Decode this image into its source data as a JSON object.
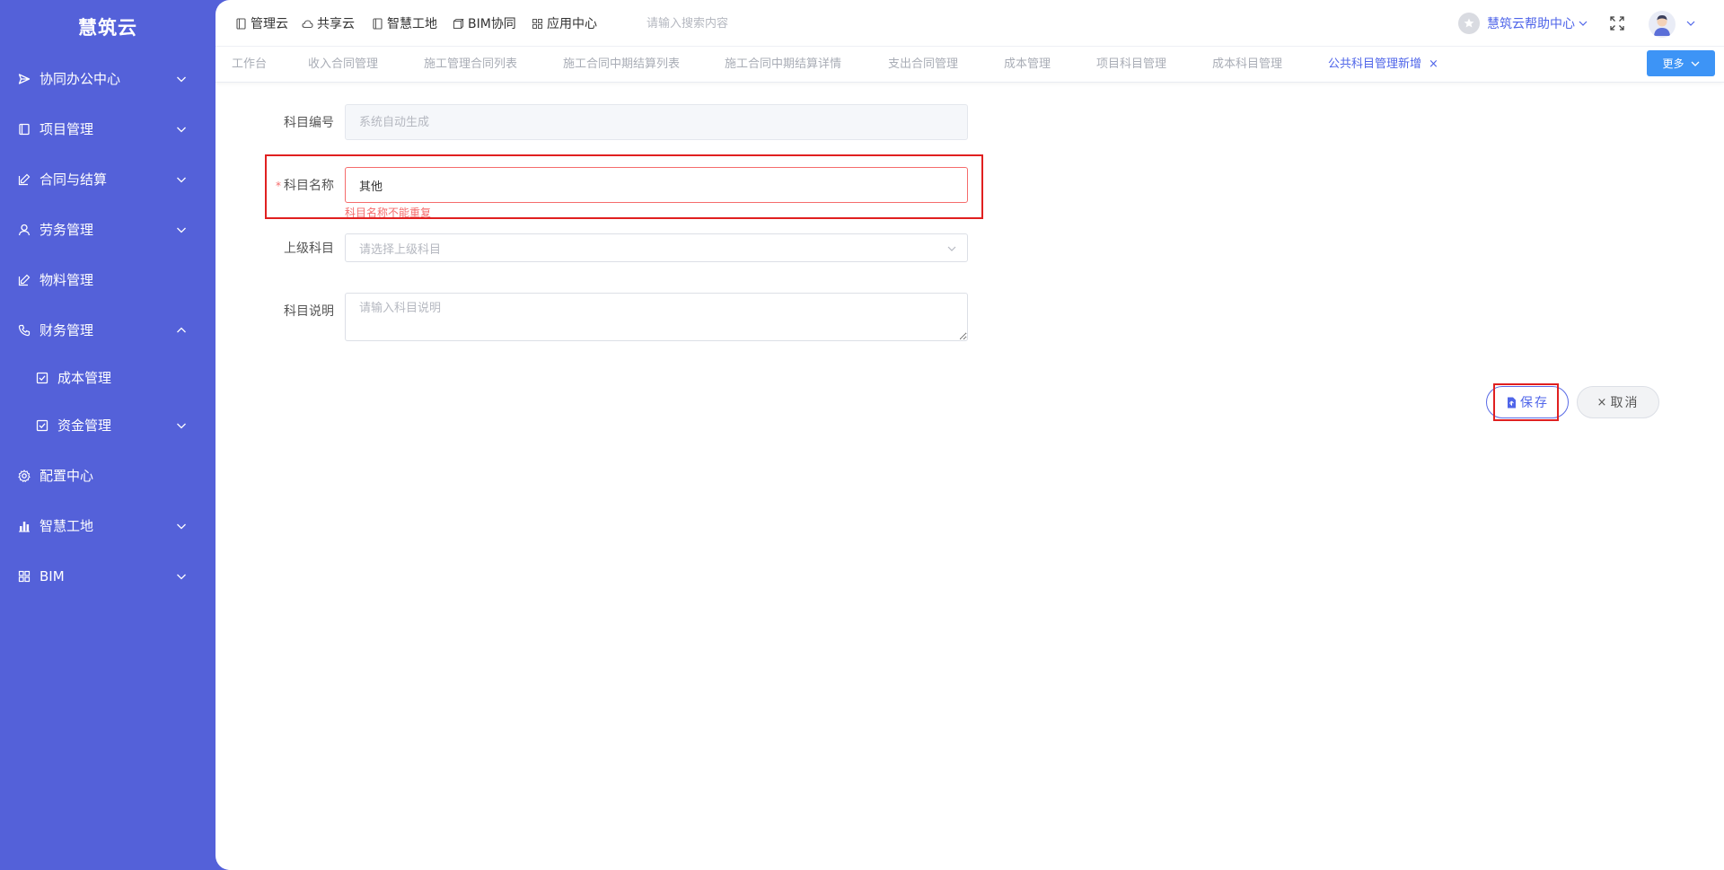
{
  "sidebar": {
    "brand": "慧筑云",
    "items": [
      {
        "label": "协同办公中心",
        "icon": "send-icon"
      },
      {
        "label": "项目管理",
        "icon": "book-icon"
      },
      {
        "label": "合同与结算",
        "icon": "edit-icon"
      },
      {
        "label": "劳务管理",
        "icon": "worker-icon"
      },
      {
        "label": "物料管理",
        "icon": "edit-icon"
      },
      {
        "label": "财务管理",
        "icon": "phone-icon",
        "expanded": true
      },
      {
        "label": "成本管理",
        "icon": "checkbox-icon",
        "sub": true
      },
      {
        "label": "资金管理",
        "icon": "checkbox-icon",
        "sub": true
      },
      {
        "label": "配置中心",
        "icon": "gear-icon"
      },
      {
        "label": "智慧工地",
        "icon": "bar-chart-icon"
      },
      {
        "label": "BIM",
        "icon": "grid-icon"
      }
    ]
  },
  "header": {
    "menus": [
      {
        "label": "管理云",
        "icon": "doc-icon"
      },
      {
        "label": "共享云",
        "icon": "cloud-icon"
      },
      {
        "label": "智慧工地",
        "icon": "doc-icon"
      },
      {
        "label": "BIM协同",
        "icon": "cube-icon"
      },
      {
        "label": "应用中心",
        "icon": "grid-icon"
      }
    ],
    "search_placeholder": "请输入搜索内容",
    "help_label": "慧筑云帮助中心"
  },
  "tabs": {
    "items": [
      "工作台",
      "收入合同管理",
      "施工管理合同列表",
      "施工合同中期结算列表",
      "施工合同中期结算详情",
      "支出合同管理",
      "成本管理",
      "项目科目管理",
      "成本科目管理",
      "公共科目管理新增"
    ],
    "active_index": 9,
    "close_label": "×",
    "more_label": "更多"
  },
  "form": {
    "code": {
      "label": "科目编号",
      "placeholder": "系统自动生成"
    },
    "name": {
      "label": "科目名称",
      "required_mark": "*",
      "value": "其他",
      "error": "科目名称不能重复"
    },
    "parent": {
      "label": "上级科目",
      "placeholder": "请选择上级科目"
    },
    "desc": {
      "label": "科目说明",
      "placeholder": "请输入科目说明"
    }
  },
  "actions": {
    "save_label": "保存",
    "cancel_label": "取消",
    "cancel_icon": "×"
  },
  "colors": {
    "sidebar": "#5461d9",
    "accent": "#4f65e9",
    "error": "#f56c6c",
    "highlight": "#e02020",
    "more_button": "#3d94f6"
  }
}
